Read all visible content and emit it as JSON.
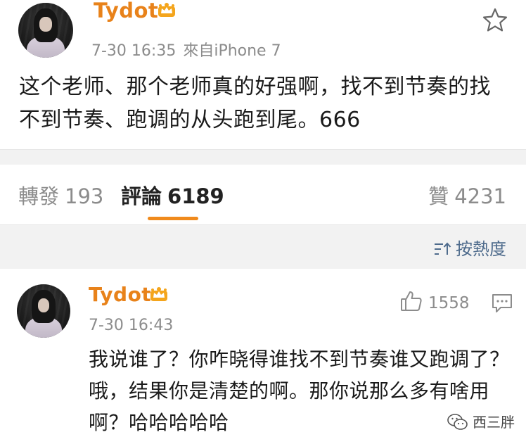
{
  "post": {
    "username": "Tydot",
    "time": "7-30 16:35",
    "source": "來自iPhone 7",
    "text": "这个老师、那个老师真的好强啊，找不到节奏的找不到节奏、跑调的从头跑到尾。666",
    "icons": {
      "favorite": "star-outline-icon",
      "vip": "crown-icon"
    }
  },
  "tabs": [
    {
      "label": "轉發",
      "count": "193"
    },
    {
      "label": "評論",
      "count": "6189"
    },
    {
      "label": "贊",
      "count": "4231"
    }
  ],
  "sort": {
    "label": "按熱度",
    "icon": "sort-icon"
  },
  "comment": {
    "username": "Tydot",
    "time": "7-30 16:43",
    "like_count": "1558",
    "text": "我说谁了？你咋晓得谁找不到节奏谁又跑调了？哦，结果你是清楚的啊。那你说那么多有啥用啊？哈哈哈哈哈",
    "icons": {
      "like": "thumbs-up-icon",
      "reply": "comment-bubble-icon"
    }
  },
  "watermark": {
    "text": "西三胖",
    "icon": "wechat-icon"
  },
  "colors": {
    "username": "#e8821a",
    "accent_underline": "#f08a1c",
    "meta_gray": "#8c8c8c",
    "sort_blue": "#4e6b8c",
    "background_gray": "#f2f2f2"
  }
}
